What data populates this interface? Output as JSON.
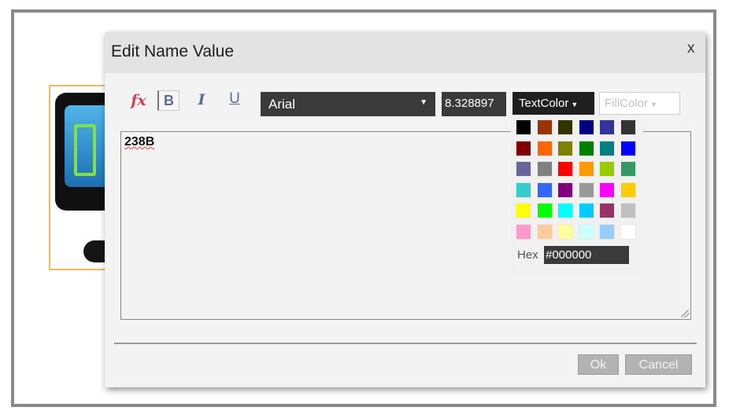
{
  "dialog": {
    "title": "Edit Name Value",
    "close_label": "x"
  },
  "toolbar": {
    "fx_label": "fx",
    "bold_label": "B",
    "italic_label": "I",
    "underline_label": "U",
    "font_family": "Arial",
    "font_size": "8.328897",
    "text_color_label": "TextColor",
    "fill_color_label": "FillColor"
  },
  "editor": {
    "text": "238B"
  },
  "palette": {
    "colors": [
      "#000000",
      "#993300",
      "#333300",
      "#000080",
      "#333399",
      "#333333",
      "#800000",
      "#ff6600",
      "#808000",
      "#008000",
      "#008080",
      "#0000ff",
      "#666699",
      "#808080",
      "#ff0000",
      "#ff9900",
      "#99cc00",
      "#339966",
      "#33cccc",
      "#3366ff",
      "#800080",
      "#999999",
      "#ff00ff",
      "#ffcc00",
      "#ffff00",
      "#00ff00",
      "#00ffff",
      "#00ccff",
      "#993366",
      "#c0c0c0",
      "#ff99cc",
      "#ffcc99",
      "#ffff99",
      "#ccffff",
      "#99ccff",
      "#ffffff"
    ],
    "hex_label": "Hex",
    "hex_value": "#000000"
  },
  "footer": {
    "ok_label": "Ok",
    "cancel_label": "Cancel"
  }
}
